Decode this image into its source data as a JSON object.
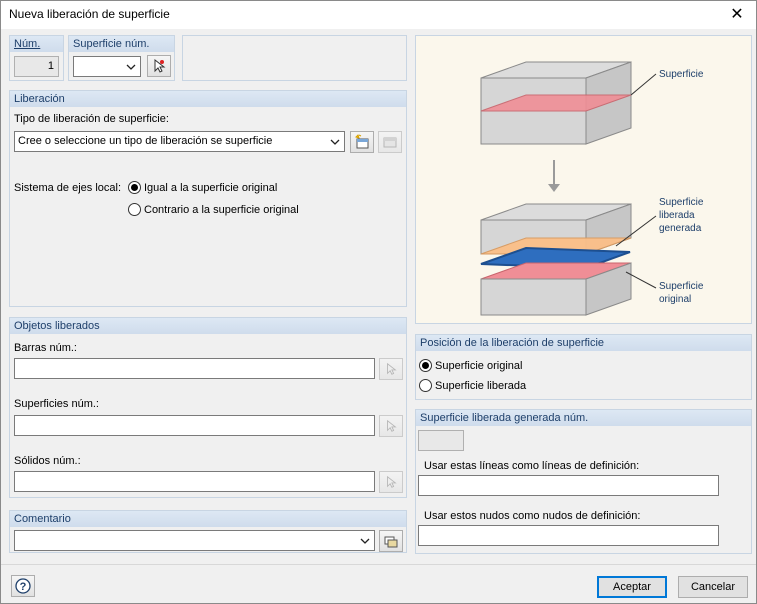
{
  "window": {
    "title": "Nueva liberación de superficie"
  },
  "num": {
    "label": "Núm.",
    "value": "1"
  },
  "surface_num": {
    "label": "Superficie núm.",
    "value": ""
  },
  "liberacion": {
    "header": "Liberación",
    "type_label": "Tipo de liberación de superficie:",
    "type_value": "Cree o seleccione un tipo de liberación se superficie",
    "axes_label": "Sistema de ejes local:",
    "axes_options": [
      "Igual a la superficie original",
      "Contrario a la superficie original"
    ],
    "axes_selected": 0
  },
  "diagram": {
    "label_surface": "Superficie",
    "label_generated": [
      "Superficie",
      "liberada",
      "generada"
    ],
    "label_original": [
      "Superficie",
      "original"
    ]
  },
  "objetos": {
    "header": "Objetos liberados",
    "bars_label": "Barras núm.:",
    "bars_value": "",
    "surfaces_label": "Superficies núm.:",
    "surfaces_value": "",
    "solids_label": "Sólidos núm.:",
    "solids_value": ""
  },
  "posicion": {
    "header": "Posición de la liberación de superficie",
    "options": [
      "Superficie original",
      "Superficie liberada"
    ],
    "selected": 0
  },
  "generada": {
    "header": "Superficie liberada generada núm.",
    "num_value": "",
    "lines_label": "Usar estas líneas como líneas de definición:",
    "lines_value": "",
    "nodes_label": "Usar estos nudos como nudos de definición:",
    "nodes_value": ""
  },
  "comentario": {
    "header": "Comentario",
    "value": ""
  },
  "footer": {
    "ok_label": "Aceptar",
    "cancel_label": "Cancelar"
  }
}
